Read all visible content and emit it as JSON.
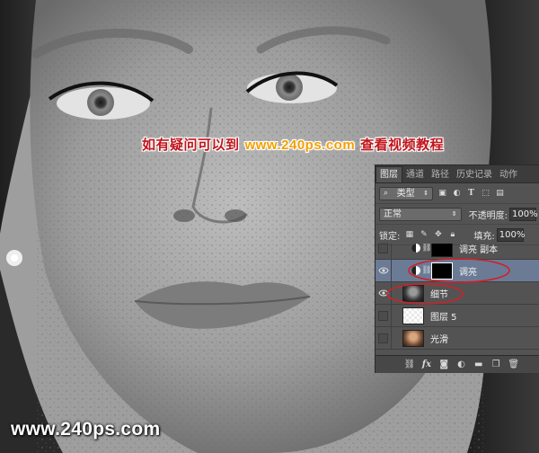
{
  "watermark": {
    "prefix": "如有疑问可以到",
    "url": "www.240ps.com",
    "suffix": "查看视频教程"
  },
  "brand": {
    "text": "www.240ps.com"
  },
  "panel": {
    "tabs": [
      {
        "label": "图层",
        "active": true
      },
      {
        "label": "通道",
        "active": false
      },
      {
        "label": "路径",
        "active": false
      },
      {
        "label": "历史记录",
        "active": false
      },
      {
        "label": "动作",
        "active": false
      }
    ],
    "filter": {
      "kind": "类型",
      "icons": [
        "image-filter-icon",
        "adjustment-filter-icon",
        "type-filter-icon",
        "shape-filter-icon",
        "smart-object-filter-icon"
      ]
    },
    "blend_mode": "正常",
    "opacity_label": "不透明度:",
    "opacity_value": "100%",
    "lock_label": "锁定:",
    "fill_label": "填充:",
    "fill_value": "100%",
    "layers": [
      {
        "name": "调亮 副本",
        "visible": false,
        "selected": false,
        "thumb": "black",
        "adjustment": true
      },
      {
        "name": "调亮",
        "visible": true,
        "selected": true,
        "thumb": "black",
        "adjustment": true
      },
      {
        "name": "细节",
        "visible": true,
        "selected": false,
        "thumb": "face",
        "adjustment": false
      },
      {
        "name": "图层 5",
        "visible": false,
        "selected": false,
        "thumb": "checker",
        "adjustment": false
      },
      {
        "name": "光滑",
        "visible": false,
        "selected": false,
        "thumb": "warm",
        "adjustment": false
      }
    ],
    "footer_icons": [
      "link-layers-icon",
      "fx-icon",
      "add-mask-icon",
      "new-adjustment-icon",
      "new-group-icon",
      "new-layer-icon",
      "delete-layer-icon"
    ],
    "highlight_color": "#d0212a"
  }
}
